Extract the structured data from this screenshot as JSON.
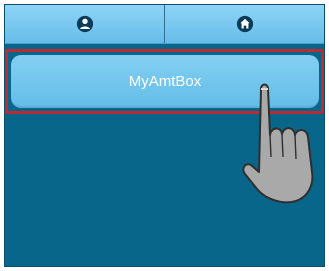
{
  "toolbar": {
    "tabs": [
      {
        "icon": "user-icon"
      },
      {
        "icon": "home-icon"
      }
    ]
  },
  "main": {
    "app_button_label": "MyAmtBox"
  },
  "colors": {
    "background": "#07668a",
    "toolbar": "#7fcbf1",
    "button": "#73c6ee",
    "highlight": "#b72c35"
  },
  "overlay": {
    "icon": "tap-hand-icon"
  }
}
